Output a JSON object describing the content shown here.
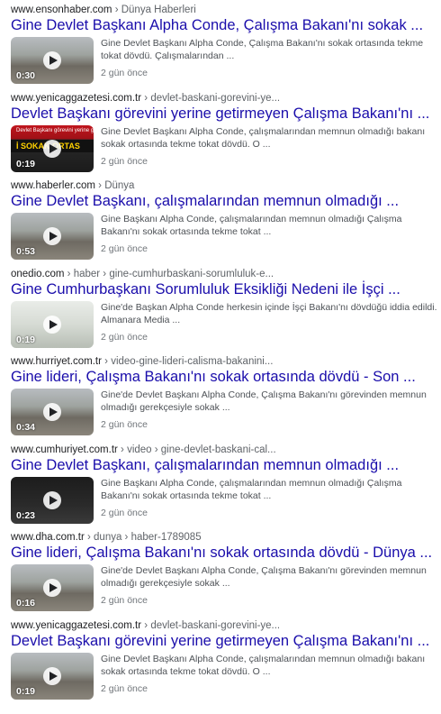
{
  "results": [
    {
      "domain": "www.ensonhaber.com",
      "path": " › Dünya Haberleri",
      "title": "Gine Devlet Başkanı Alpha Conde, Çalışma Bakanı'nı sokak ...",
      "snippet": "Gine Devlet Başkanı Alpha Conde, Çalışma Bakanı'nı sokak ortasında tekme tokat dövdü. Çalışmalarından ...",
      "duration": "0:30",
      "age": "2 gün önce",
      "thumb": "street"
    },
    {
      "domain": "www.yenicaggazetesi.com.tr",
      "path": " › devlet-baskani-gorevini-ye...",
      "title": "Devlet Başkanı görevini yerine getirmeyen Çalışma Bakanı'nı ...",
      "snippet": "Gine Devlet Başkanı Alpha Conde, çalışmalarından memnun olmadığı bakanı sokak ortasında tekme tokat dövdü. O ...",
      "duration": "0:19",
      "age": "2 gün önce",
      "thumb": "news",
      "banner": "İ SOKAK ORTAS",
      "topline": "Devlet Başkanı görevini yerine getir"
    },
    {
      "domain": "www.haberler.com",
      "path": " › Dünya",
      "title": "Gine Devlet Başkanı, çalışmalarından memnun olmadığı ...",
      "snippet": "Gine Başkanı Alpha Conde, çalışmalarından memnun olmadığı Çalışma Bakanı'nı sokak ortasında tekme tokat ...",
      "duration": "0:53",
      "age": "2 gün önce",
      "thumb": "street"
    },
    {
      "domain": "onedio.com",
      "path": " › haber › gine-cumhurbaskani-sorumluluk-e...",
      "title": "Gine Cumhurbaşkanı Sorumluluk Eksikliği Nedeni ile İşçi ...",
      "snippet": "Gine'de Başkan Alpha Conde herkesin içinde İşçi Bakanı'nı dövdüğü iddia edildi. Almanara Media ...",
      "duration": "0:19",
      "age": "2 gün önce",
      "thumb": "light"
    },
    {
      "domain": "www.hurriyet.com.tr",
      "path": " › video-gine-lideri-calisma-bakanini...",
      "title": "Gine lideri, Çalışma Bakanı'nı sokak ortasında dövdü - Son ...",
      "snippet": "Gine'de Devlet Başkanı Alpha Conde, Çalışma Bakanı'nı görevinden memnun olmadığı gerekçesiyle sokak ...",
      "duration": "0:34",
      "age": "2 gün önce",
      "thumb": "street"
    },
    {
      "domain": "www.cumhuriyet.com.tr",
      "path": " › video › gine-devlet-baskani-cal...",
      "title": "Gine Devlet Başkanı, çalışmalarından memnun olmadığı ...",
      "snippet": "Gine Başkanı Alpha Conde, çalışmalarından memnun olmadığı Çalışma Bakanı'nı sokak ortasında tekme tokat ...",
      "duration": "0:23",
      "age": "2 gün önce",
      "thumb": "dark"
    },
    {
      "domain": "www.dha.com.tr",
      "path": " › dunya › haber-1789085",
      "title": "Gine lideri, Çalışma Bakanı'nı sokak ortasında dövdü - Dünya ...",
      "snippet": "Gine'de Devlet Başkanı Alpha Conde, Çalışma Bakanı'nı görevinden memnun olmadığı gerekçesiyle sokak ...",
      "duration": "0:16",
      "age": "2 gün önce",
      "thumb": "street"
    },
    {
      "domain": "www.yenicaggazetesi.com.tr",
      "path": " › devlet-baskani-gorevini-ye...",
      "title": "Devlet Başkanı görevini yerine getirmeyen Çalışma Bakanı'nı ...",
      "snippet": "Gine Devlet Başkanı Alpha Conde, çalışmalarından memnun olmadığı bakanı sokak ortasında tekme tokat dövdü. O ...",
      "duration": "0:19",
      "age": "2 gün önce",
      "thumb": "street"
    }
  ]
}
